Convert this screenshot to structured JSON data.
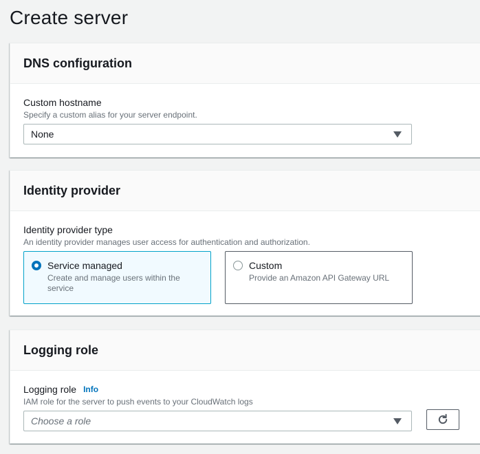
{
  "page": {
    "title": "Create server"
  },
  "dns": {
    "header": "DNS configuration",
    "hostname_label": "Custom hostname",
    "hostname_desc": "Specify a custom alias for your server endpoint.",
    "hostname_value": "None"
  },
  "identity": {
    "header": "Identity provider",
    "type_label": "Identity provider type",
    "type_desc": "An identity provider manages user access for authentication and authorization.",
    "options": [
      {
        "title": "Service managed",
        "desc": "Create and manage users within the service",
        "selected": true
      },
      {
        "title": "Custom",
        "desc": "Provide an Amazon API Gateway URL",
        "selected": false
      }
    ]
  },
  "logging": {
    "header": "Logging role",
    "role_label": "Logging role",
    "info_link": "Info",
    "role_desc": "IAM role for the server to push events to your CloudWatch logs",
    "role_placeholder": "Choose a role",
    "icons": {
      "refresh": "refresh-icon",
      "caret": "caret-down-icon"
    }
  },
  "colors": {
    "accent": "#0073bb",
    "selected_border": "#00a1c9",
    "selected_bg": "#f1faff"
  }
}
